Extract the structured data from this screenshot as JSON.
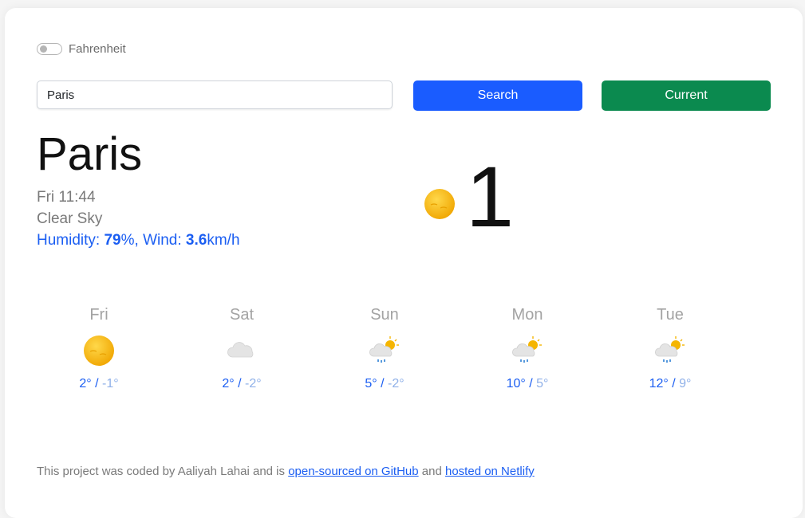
{
  "units": {
    "label": "Fahrenheit",
    "checked": false
  },
  "search": {
    "value": "Paris",
    "button_label": "Search"
  },
  "current_button_label": "Current",
  "colors": {
    "primary": "#1b5ef2",
    "search_button": "#1a5cff",
    "current_button": "#0b8a4f",
    "muted_text": "#7a7a7a",
    "sun": "#f5b500"
  },
  "weather": {
    "city": "Paris",
    "date": "Fri 11:44",
    "description": "Clear Sky",
    "humidity_label": "Humidity: ",
    "humidity_value": "79",
    "humidity_unit": "%",
    "wind_label": ", Wind: ",
    "wind_value": "3.6",
    "wind_unit": "km/h",
    "temperature": "1",
    "icon": "sun-icon"
  },
  "forecast": [
    {
      "day": "Fri",
      "max": "2°",
      "min": "-1°",
      "icon": "sun-icon"
    },
    {
      "day": "Sat",
      "max": "2°",
      "min": "-2°",
      "icon": "cloud-icon"
    },
    {
      "day": "Sun",
      "max": "5°",
      "min": "-2°",
      "icon": "sun-cloud-rain-icon"
    },
    {
      "day": "Mon",
      "max": "10°",
      "min": "5°",
      "icon": "sun-cloud-rain-icon"
    },
    {
      "day": "Tue",
      "max": "12°",
      "min": "9°",
      "icon": "sun-cloud-rain-icon"
    }
  ],
  "footer": {
    "text_before": "This project was coded by Aaliyah Lahai and is ",
    "github_link": "open-sourced on GitHub",
    "text_middle": " and ",
    "netlify_link": "hosted on Netlify"
  }
}
